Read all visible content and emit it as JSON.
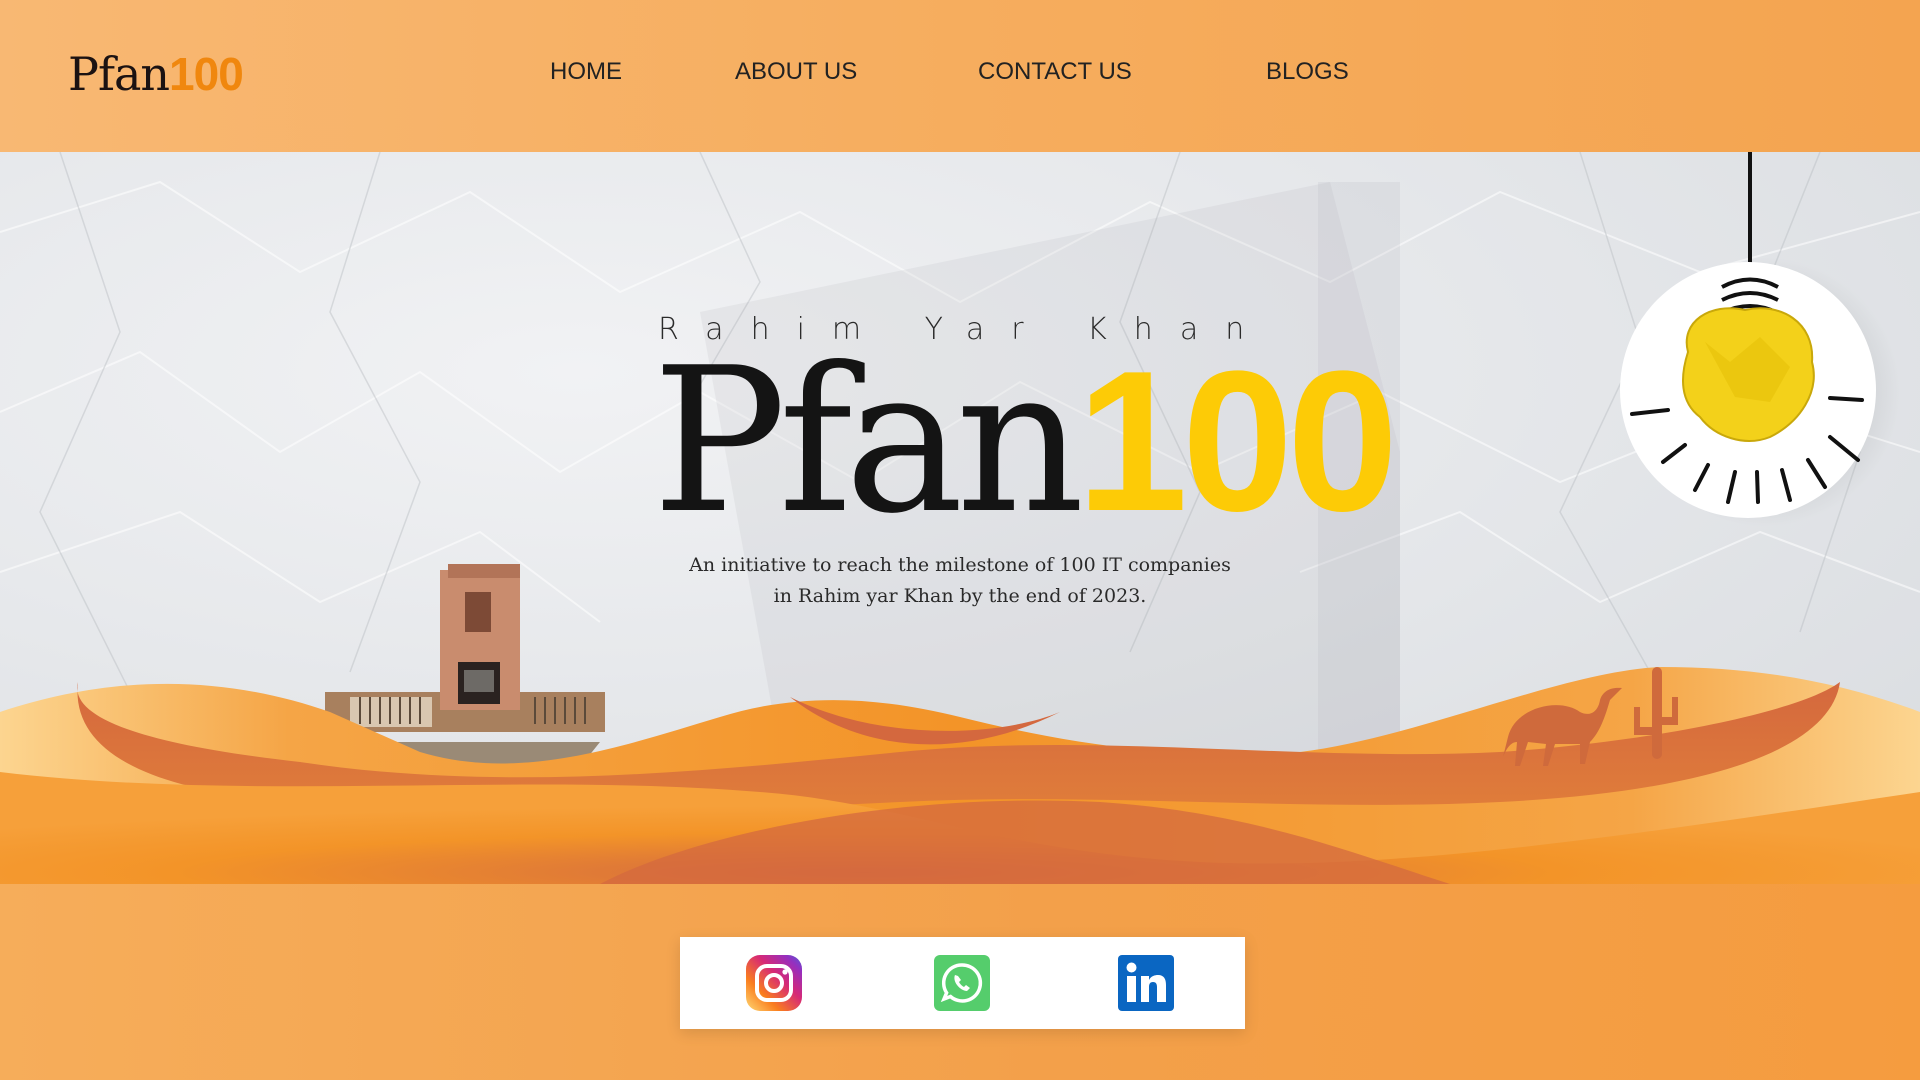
{
  "header": {
    "logo": {
      "word": "Pfan",
      "number": "100"
    },
    "nav": [
      {
        "label": "HOME"
      },
      {
        "label": "ABOUT US"
      },
      {
        "label": "CONTACT US"
      },
      {
        "label": "BLOGS"
      }
    ]
  },
  "hero": {
    "location": "Rahim Yar Khan",
    "title": {
      "word": "Pfan",
      "number": "100"
    },
    "description": [
      "An initiative to reach the milestone of 100 IT companies",
      "in Rahim yar Khan by the end of 2023."
    ]
  },
  "social": {
    "icons": [
      "instagram-icon",
      "whatsapp-icon",
      "linkedin-icon"
    ]
  },
  "colors": {
    "header_bg": "#f6ad5e",
    "accent_orange": "#f0870e",
    "accent_yellow": "#fdcb06",
    "dune_orange": "#f39428",
    "dune_dark": "#d4683e"
  }
}
